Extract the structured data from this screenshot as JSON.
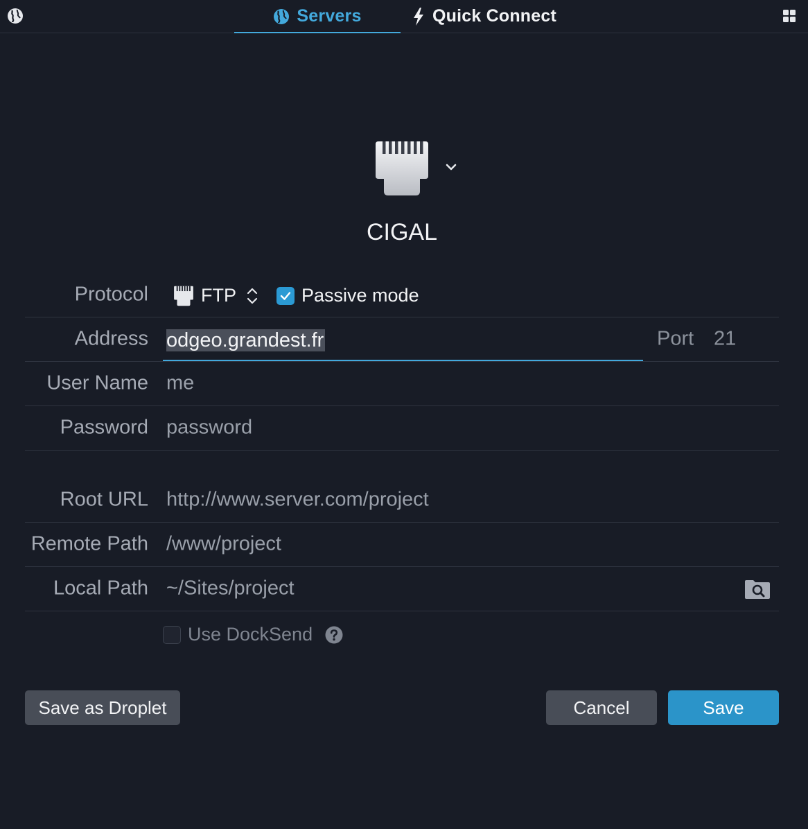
{
  "tabs": {
    "servers_label": "Servers",
    "quick_connect_label": "Quick Connect"
  },
  "icons": {
    "globe": "globe-icon",
    "grid": "grid-icon",
    "bolt": "lightning-icon",
    "server": "ethernet-port-icon",
    "folder_search": "folder-search-icon",
    "help": "question-mark-icon"
  },
  "server": {
    "name": "CIGAL"
  },
  "form": {
    "protocol": {
      "label": "Protocol",
      "value": "FTP",
      "passive_mode_label": "Passive mode",
      "passive_mode_checked": true
    },
    "address": {
      "label": "Address",
      "value": "odgeo.grandest.fr",
      "port_label": "Port",
      "port_value": "21"
    },
    "user_name": {
      "label": "User Name",
      "placeholder": "me"
    },
    "password": {
      "label": "Password",
      "placeholder": "password"
    },
    "root_url": {
      "label": "Root URL",
      "placeholder": "http://www.server.com/project"
    },
    "remote_path": {
      "label": "Remote Path",
      "placeholder": "/www/project"
    },
    "local_path": {
      "label": "Local Path",
      "placeholder": "~/Sites/project"
    },
    "docksend": {
      "label": "Use DockSend",
      "checked": false
    }
  },
  "buttons": {
    "save_as_droplet": "Save as Droplet",
    "cancel": "Cancel",
    "save": "Save"
  },
  "colors": {
    "background": "#181c26",
    "accent": "#43a9dc",
    "save_button": "#2b94c9",
    "secondary_button": "#484d57"
  }
}
